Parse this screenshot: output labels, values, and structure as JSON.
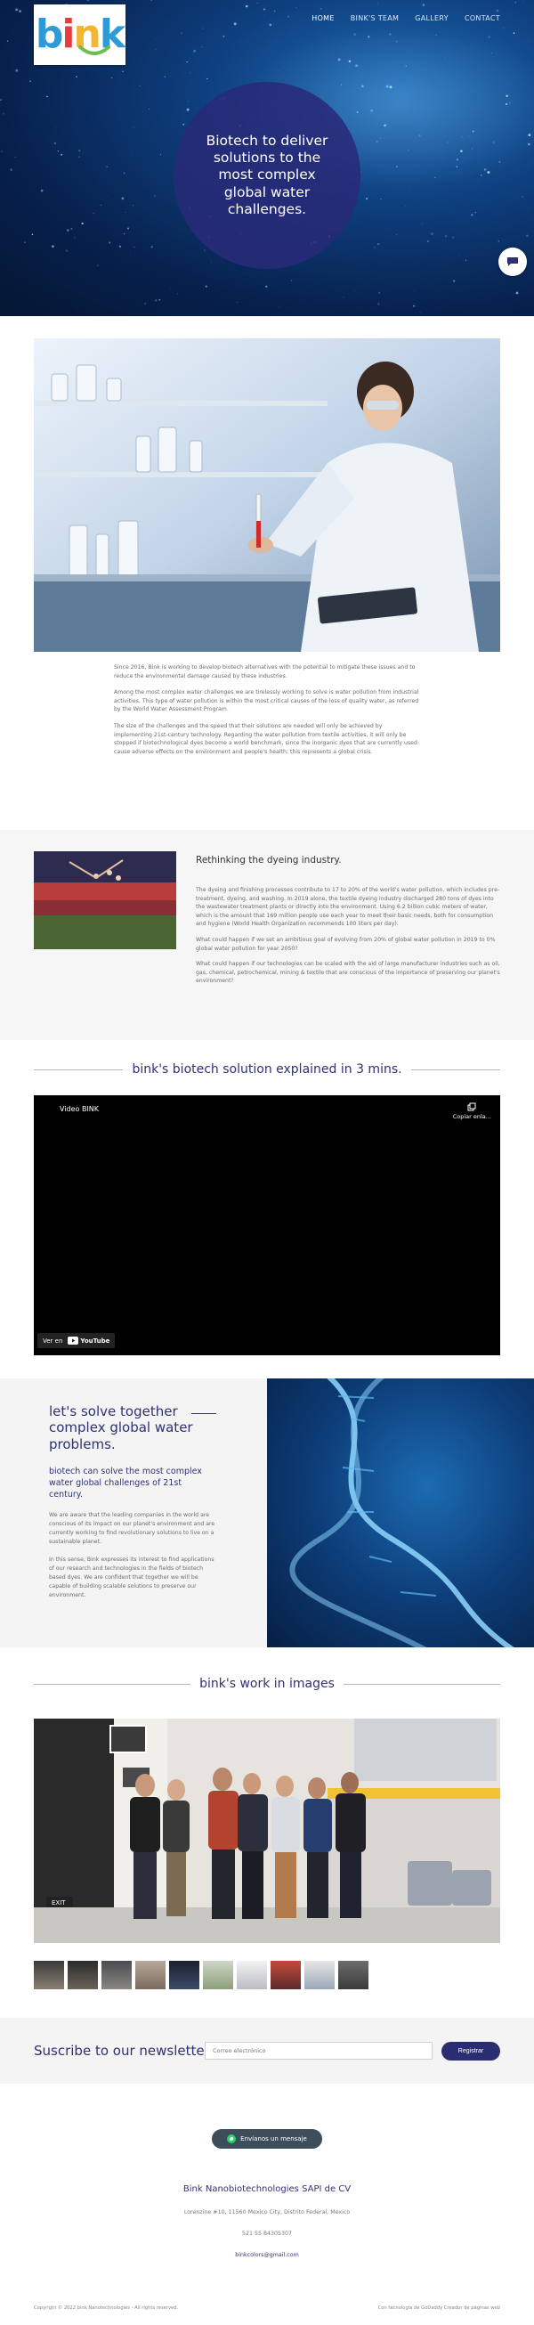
{
  "header": {
    "logo_text": "bink",
    "nav": [
      "HOME",
      "BINK'S TEAM",
      "GALLERY",
      "CONTACT"
    ],
    "active_nav": "HOME"
  },
  "hero": {
    "headline": "Biotech to deliver solutions to the most complex global water challenges."
  },
  "intro": {
    "paragraphs": [
      "Since 2016, Bink is working to develop biotech alternatives with the potential to mitigate these issues and to reduce the environmental damage caused by these industries.",
      "Among the most complex water challenges we are tirelessly working to solve is water pollution from industrial activities. This type of water pollution is within the most critical causes of the loss of quality water, as referred by the World Water Assessment Program.",
      "The size of the challenges and the speed that their solutions are needed will only be achieved by implementing 21st-century technology. Regarding the water pollution from textile activities, it will only be stopped if biotechnological dyes become a world benchmark, since the inorganic dyes that are currently used cause adverse effects on the environment and people's health; this represents a global crisis."
    ]
  },
  "dyeing": {
    "title": "Rethinking the dyeing industry.",
    "paragraphs": [
      "The dyeing and finishing processes contribute to 17 to 20% of the world's water pollution, which includes pre-treatment, dyeing, and washing. In 2019 alone, the textile dyeing industry discharged 280 tons of dyes into the wastewater treatment plants or directly into the environment. Using 6.2 billion cubic meters of water, which is the amount that 169 million people use each year to meet their basic needs, both for consumption and hygiene (World Health Organization recommends 100 liters per day).",
      "What could happen if we set an ambitious goal of evolving from 20% of global water pollution in 2019 to 0% global water pollution for year 2050?",
      "What could happen if our technologies can be scaled with the aid of large manufacturer industries such as oil, gas, chemical, petrochemical, mining & textile that are conscious of the importance of preserving our planet's environment?"
    ]
  },
  "video_section": {
    "heading": "bink's biotech solution explained in 3 mins.",
    "video_title": "Video BINK",
    "copy_link": "Copiar enla...",
    "watch_on": "Ver en",
    "youtube": "YouTube"
  },
  "solve": {
    "title": "let's solve together complex global water problems.",
    "subtitle": "biotech can solve the most complex water global challenges of 21st century.",
    "paragraphs": [
      "We are aware that the leading companies in the world are conscious of its impact on our planet's environment and are currently working to find revolutionary solutions to live on a sustainable planet.",
      "In this sense, Bink expresses its interest to find applications of our research and technologies in the fields of biotech based dyes. We are confident that together we will be capable of building scalable solutions to preserve our environment."
    ]
  },
  "gallery": {
    "heading": "bink's work in images",
    "exit_sign": "EXIT",
    "thumb_count": 10
  },
  "newsletter": {
    "title": "Suscribe to our newsletter",
    "placeholder": "Correo electrónico",
    "button": "Registrar"
  },
  "footer": {
    "whatsapp": "Envíanos un mensaje",
    "company": "Bink Nanobiotechnologies SAPI de CV",
    "address": "Lorenzine #10, 11560 Mexico City, Distrito Federal, Mexico",
    "phone": "521 55 84305307",
    "email": "binkcolors@gmail.com",
    "copyright": "Copyright © 2022 bink Nanotechnologies - All rights reserved.",
    "builder": "Con tecnología de GoDaddy Creador de páginas web"
  },
  "colors": {
    "brand_navy": "#2e3175",
    "logo_b": "#2e9ad6",
    "logo_i": "#e53b3b",
    "logo_n": "#f2b632",
    "logo_k": "#2e9ad6",
    "smile": "#6cbf4a"
  }
}
